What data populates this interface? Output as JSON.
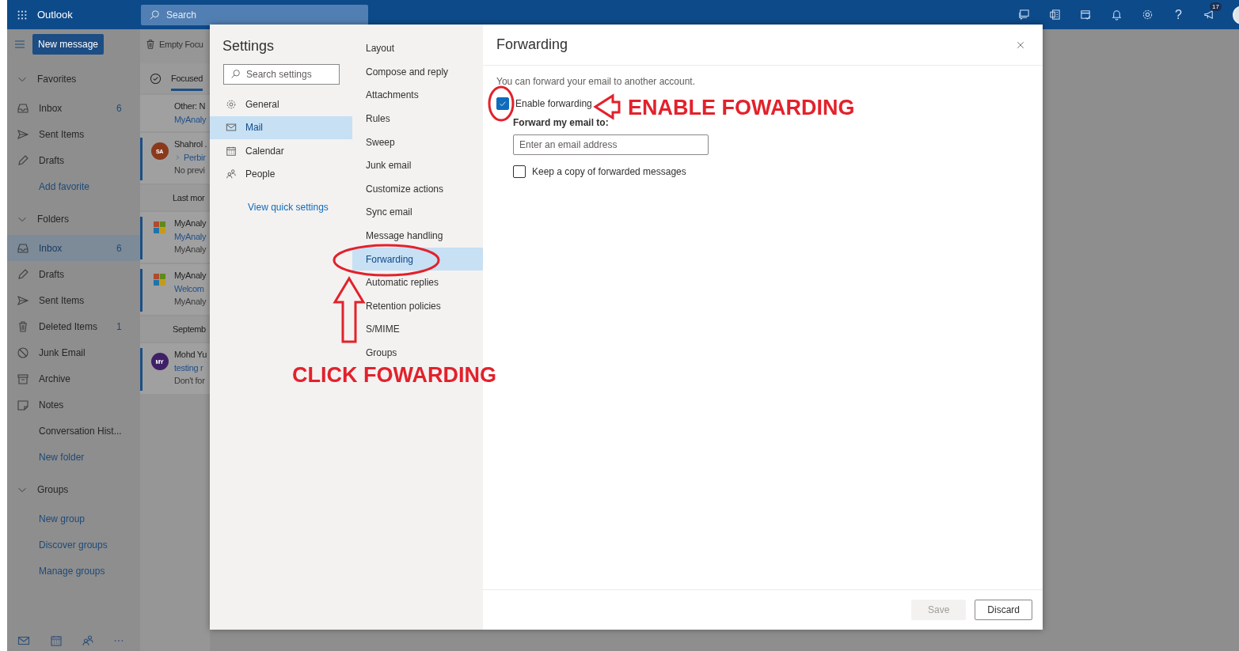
{
  "top_bar": {
    "app_name": "Outlook",
    "search": {
      "placeholder": "Search"
    },
    "help": "?",
    "notification_count": "17"
  },
  "toolbar": {
    "new_message": "New message",
    "empty_action": "Empty Focu"
  },
  "sidebar": {
    "items": [
      {
        "kind": "header",
        "label": "Favorites",
        "expanded": true
      },
      {
        "kind": "inbox",
        "label": "Inbox",
        "count": "6",
        "selected": false
      },
      {
        "kind": "sent",
        "label": "Sent Items",
        "selected": false
      },
      {
        "kind": "drafts",
        "label": "Drafts",
        "selected": false
      },
      {
        "kind": "link",
        "label": "Add favorite",
        "selected": false
      },
      {
        "kind": "header",
        "label": "Folders",
        "expanded": true
      },
      {
        "kind": "inbox",
        "label": "Inbox",
        "count": "6",
        "selected": true
      },
      {
        "kind": "drafts",
        "label": "Drafts",
        "selected": false
      },
      {
        "kind": "sent",
        "label": "Sent Items",
        "selected": false
      },
      {
        "kind": "deleted",
        "label": "Deleted Items",
        "count": "1",
        "selected": false
      },
      {
        "kind": "junk",
        "label": "Junk Email",
        "selected": false
      },
      {
        "kind": "archive",
        "label": "Archive",
        "selected": false
      },
      {
        "kind": "notes",
        "label": "Notes",
        "selected": false
      },
      {
        "kind": "plain",
        "label": "Conversation Hist...",
        "selected": false
      },
      {
        "kind": "link",
        "label": "New folder",
        "selected": false
      },
      {
        "kind": "header",
        "label": "Groups",
        "expanded": true
      },
      {
        "kind": "link",
        "label": "New group",
        "selected": false
      },
      {
        "kind": "link",
        "label": "Discover groups",
        "selected": false
      },
      {
        "kind": "link",
        "label": "Manage groups",
        "selected": false
      }
    ]
  },
  "message_list": {
    "tab": {
      "label": "Focused",
      "selected": true
    },
    "items": [
      {
        "kind": "message",
        "sender": "Other: N",
        "subject": "MyAnaly",
        "unread": false
      },
      {
        "kind": "message",
        "avatar": {
          "kind": "initials",
          "text": "SA",
          "color": "#8a3a1c"
        },
        "sender": "Shahrol .",
        "subject": "Perbir",
        "thread": true,
        "preview": "No previ",
        "unread": true
      },
      {
        "kind": "header",
        "label": "Last mor"
      },
      {
        "kind": "message",
        "avatar": {
          "kind": "logo"
        },
        "sender": "MyAnaly",
        "subject": "MyAnaly",
        "preview": "MyAnaly",
        "unread": true
      },
      {
        "kind": "message",
        "avatar": {
          "kind": "logo"
        },
        "sender": "MyAnaly",
        "subject": "Welcom",
        "preview": "MyAnaly",
        "unread": true
      },
      {
        "kind": "header",
        "label": "Septemb"
      },
      {
        "kind": "message",
        "avatar": {
          "kind": "initials",
          "text": "MY",
          "color": "#3f2066"
        },
        "sender": "Mohd Yu",
        "subject": "testing r",
        "preview": "Don't for",
        "unread": true
      }
    ]
  },
  "settings": {
    "title": "Settings",
    "search": {
      "placeholder": "Search settings"
    },
    "categories": [
      {
        "kind": "general",
        "label": "General",
        "selected": false
      },
      {
        "kind": "mail",
        "label": "Mail",
        "selected": true
      },
      {
        "kind": "calendar",
        "label": "Calendar",
        "selected": false
      },
      {
        "kind": "people",
        "label": "People",
        "selected": false
      }
    ],
    "quick_link": "View quick settings",
    "sections": [
      {
        "label": "Layout",
        "selected": false
      },
      {
        "label": "Compose and reply",
        "selected": false
      },
      {
        "label": "Attachments",
        "selected": false
      },
      {
        "label": "Rules",
        "selected": false
      },
      {
        "label": "Sweep",
        "selected": false
      },
      {
        "label": "Junk email",
        "selected": false
      },
      {
        "label": "Customize actions",
        "selected": false
      },
      {
        "label": "Sync email",
        "selected": false
      },
      {
        "label": "Message handling",
        "selected": false
      },
      {
        "label": "Forwarding",
        "selected": true
      },
      {
        "label": "Automatic replies",
        "selected": false
      },
      {
        "label": "Retention policies",
        "selected": false
      },
      {
        "label": "S/MIME",
        "selected": false
      },
      {
        "label": "Groups",
        "selected": false
      }
    ]
  },
  "forwarding": {
    "title": "Forwarding",
    "description": "You can forward your email to another account.",
    "enable": {
      "label": "Enable forwarding",
      "checked": true
    },
    "address_label": "Forward my email to:",
    "address": {
      "placeholder": "Enter an email address"
    },
    "keep_copy": {
      "label": "Keep a copy of forwarded messages",
      "checked": false
    },
    "buttons": [
      {
        "label": "Save",
        "disabled": true
      },
      {
        "label": "Discard",
        "disabled": false
      }
    ]
  },
  "annotations": [
    {
      "text": "ENABLE FOWARDING"
    },
    {
      "text": "CLICK FOWARDING"
    }
  ]
}
